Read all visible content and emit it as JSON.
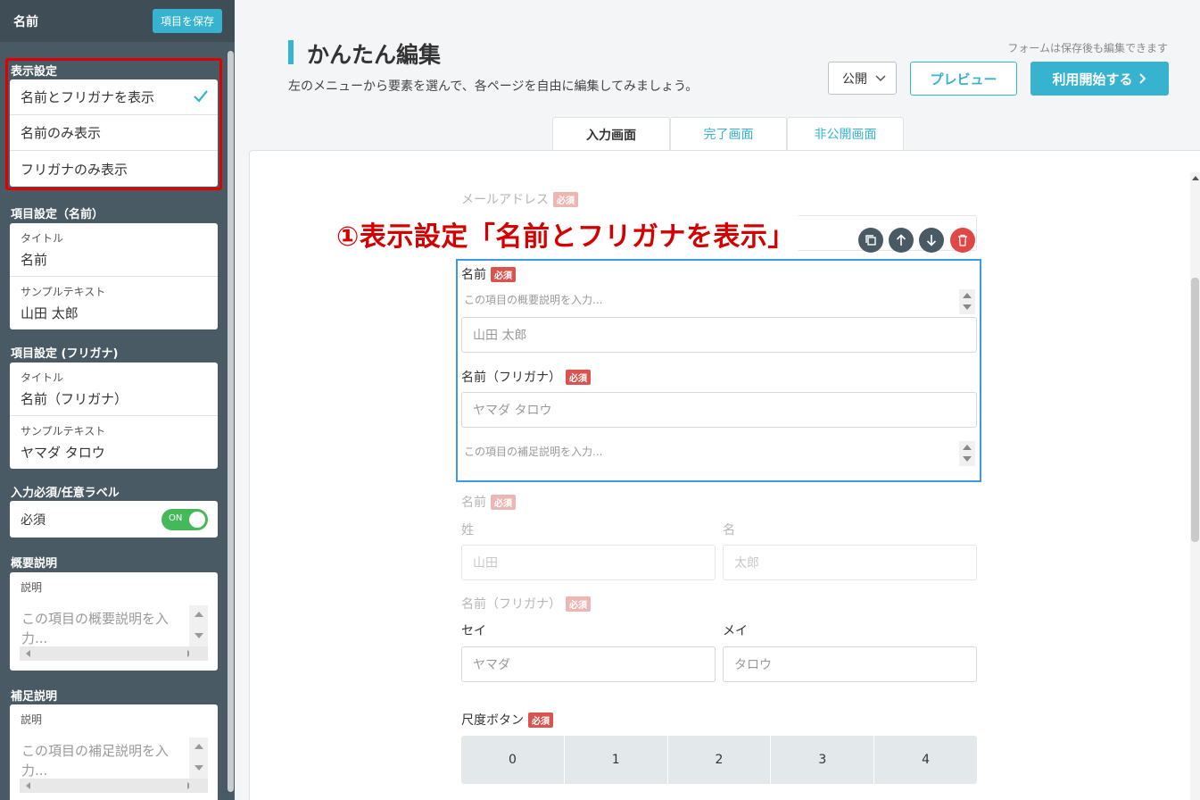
{
  "sidebar": {
    "title": "名前",
    "save_label": "項目を保存",
    "display_section": {
      "label": "表示設定",
      "options": [
        "名前とフリガナを表示",
        "名前のみ表示",
        "フリガナのみ表示"
      ],
      "selected": "名前とフリガナを表示"
    },
    "name_section": {
      "label": "項目設定（名前）",
      "title_label": "タイトル",
      "title_value": "名前",
      "sample_label": "サンプルテキスト",
      "sample_value": "山田 太郎"
    },
    "kana_section": {
      "label": "項目設定 (フリガナ)",
      "title_label": "タイトル",
      "title_value": "名前（フリガナ）",
      "sample_label": "サンプルテキスト",
      "sample_value": "ヤマダ タロウ"
    },
    "required_section": {
      "label": "入力必須/任意ラベル",
      "value": "必須",
      "toggle": "ON"
    },
    "summary_section": {
      "label": "概要説明",
      "field_label": "説明",
      "placeholder": "この項目の概要説明を入力..."
    },
    "supplement_section": {
      "label": "補足説明",
      "field_label": "説明",
      "placeholder": "この項目の補足説明を入力..."
    }
  },
  "header": {
    "title": "かんたん編集",
    "subtitle": "左のメニューから要素を選んで、各ページを自由に編集してみましょう。",
    "hint": "フォームは保存後も編集できます",
    "visibility": "公開",
    "preview_label": "プレビュー",
    "start_label": "利用開始する"
  },
  "tabs": [
    "入力画面",
    "完了画面",
    "非公開画面"
  ],
  "annotation": "①表示設定「名前とフリガナを表示」",
  "form": {
    "required_badge": "必須",
    "email_label": "メールアドレス",
    "name_label": "名前",
    "summary_placeholder": "この項目の概要説明を入力...",
    "name_placeholder": "山田 太郎",
    "kana_label": "名前（フリガナ）",
    "kana_placeholder": "ヤマダ タロウ",
    "supplement_placeholder": "この項目の補足説明を入力...",
    "split_name_label": "名前",
    "sei_label": "姓",
    "mei_label": "名",
    "sei_placeholder": "山田",
    "mei_placeholder": "太郎",
    "split_kana_label": "名前（フリガナ）",
    "sei_kana_label": "セイ",
    "mei_kana_label": "メイ",
    "sei_kana_placeholder": "ヤマダ",
    "mei_kana_placeholder": "タロウ",
    "scale_label": "尺度ボタン",
    "scale_values": [
      "0",
      "1",
      "2",
      "3",
      "4"
    ]
  },
  "colors": {
    "accent": "#37b3cf",
    "sidebar": "#4a5a64",
    "annotation_red": "#d40000",
    "toggle_on": "#45b85a",
    "selection_blue": "#3d9ae3"
  }
}
